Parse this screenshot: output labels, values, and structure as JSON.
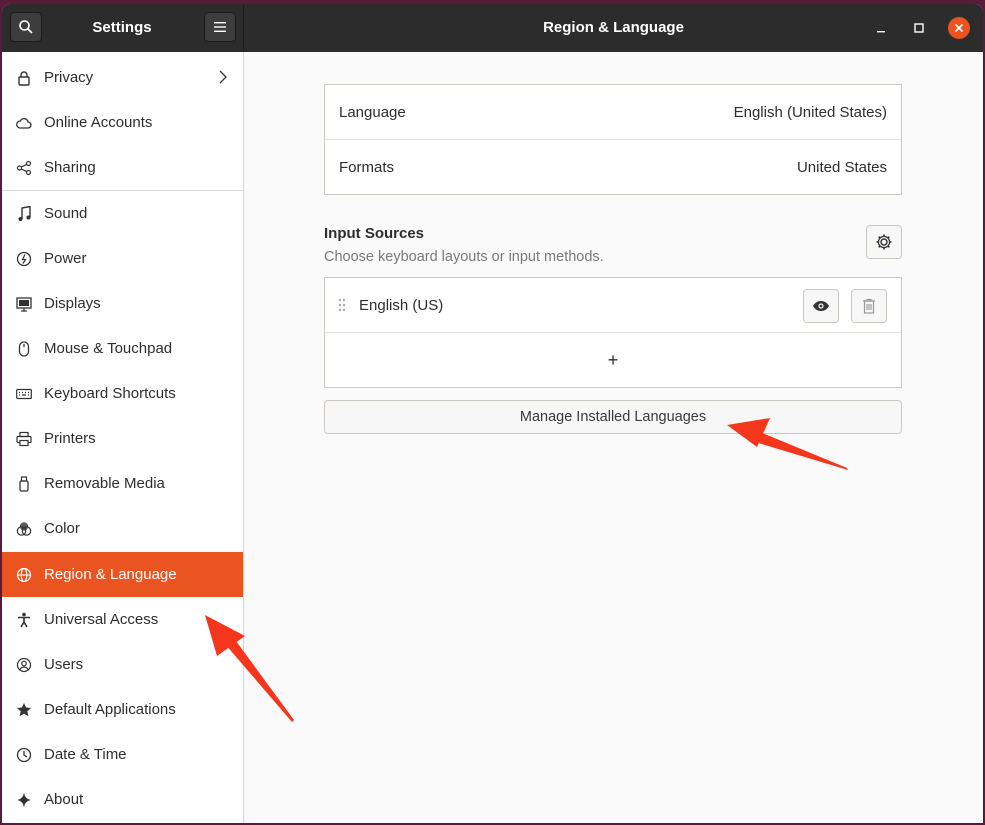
{
  "header": {
    "sidebar_title": "Settings",
    "panel_title": "Region & Language"
  },
  "sidebar": {
    "items": [
      {
        "label": "Privacy",
        "icon": "lock-icon"
      },
      {
        "label": "Online Accounts",
        "icon": "cloud-icon"
      },
      {
        "label": "Sharing",
        "icon": "share-icon"
      },
      {
        "label": "Sound",
        "icon": "music-note-icon"
      },
      {
        "label": "Power",
        "icon": "power-icon"
      },
      {
        "label": "Displays",
        "icon": "display-icon"
      },
      {
        "label": "Mouse & Touchpad",
        "icon": "mouse-icon"
      },
      {
        "label": "Keyboard Shortcuts",
        "icon": "keyboard-icon"
      },
      {
        "label": "Printers",
        "icon": "printer-icon"
      },
      {
        "label": "Removable Media",
        "icon": "usb-icon"
      },
      {
        "label": "Color",
        "icon": "color-icon"
      },
      {
        "label": "Region & Language",
        "icon": "globe-icon",
        "active": true
      },
      {
        "label": "Universal Access",
        "icon": "accessibility-icon"
      },
      {
        "label": "Users",
        "icon": "users-icon"
      },
      {
        "label": "Default Applications",
        "icon": "star-icon"
      },
      {
        "label": "Date & Time",
        "icon": "clock-icon"
      },
      {
        "label": "About",
        "icon": "sparkle-icon"
      }
    ]
  },
  "main": {
    "language_label": "Language",
    "language_value": "English (United States)",
    "formats_label": "Formats",
    "formats_value": "United States",
    "input_sources_title": "Input Sources",
    "input_sources_subtitle": "Choose keyboard layouts or input methods.",
    "input_source": "English (US)",
    "add_symbol": "+",
    "manage_button": "Manage Installed Languages"
  },
  "colors": {
    "accent": "#e95420",
    "headerbar": "#2c2c2c",
    "annotation_arrow": "#f4361c"
  }
}
